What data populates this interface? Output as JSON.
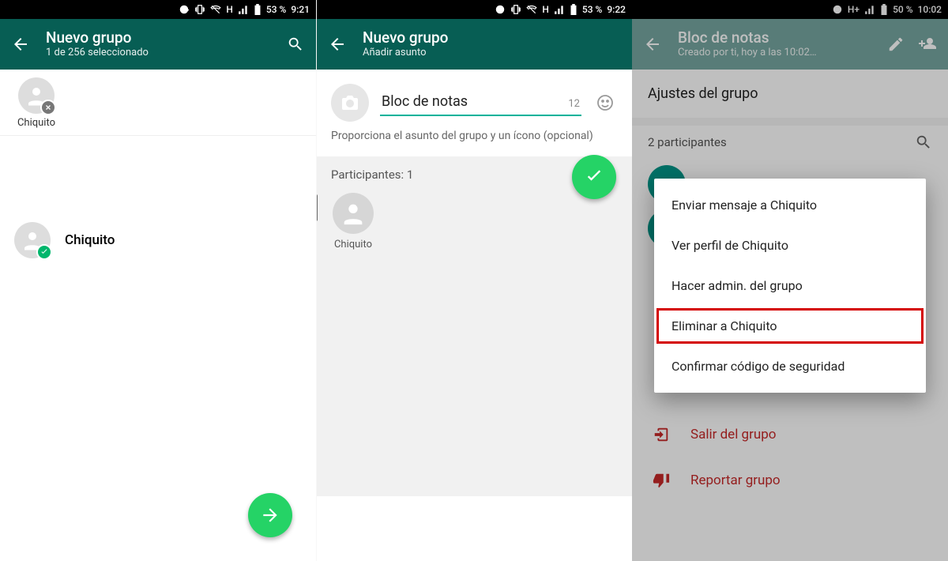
{
  "phone1": {
    "status": {
      "battery": "53 %",
      "time": "9:21",
      "net": "H"
    },
    "title": "Nuevo grupo",
    "subtitle": "1 de 256 seleccionado",
    "selected_chip": {
      "name": "Chiquito"
    },
    "contact_row": {
      "name": "Chiquito"
    }
  },
  "phone2": {
    "status": {
      "battery": "53 %",
      "time": "9:22",
      "net": "H"
    },
    "title": "Nuevo grupo",
    "subtitle": "Añadir asunto",
    "subject_value": "Bloc de notas",
    "counter": "12",
    "hint": "Proporciona el asunto del grupo y un ícono (opcional)",
    "participants_label": "Participantes: 1",
    "participant": {
      "name": "Chiquito"
    }
  },
  "phone3": {
    "status": {
      "battery": "50 %",
      "time": "10:02",
      "net": "H+"
    },
    "title": "Bloc de notas",
    "subtitle": "Creado por ti, hoy a las 10:02…",
    "section_title": "Ajustes del grupo",
    "participants_header": "2 participantes",
    "menu": {
      "item1": "Enviar mensaje a Chiquito",
      "item2": "Ver perfil de Chiquito",
      "item3": "Hacer admin. del grupo",
      "item4": "Eliminar a Chiquito",
      "item5": "Confirmar código de seguridad"
    },
    "leave_group": "Salir del grupo",
    "report_group": "Reportar grupo"
  }
}
